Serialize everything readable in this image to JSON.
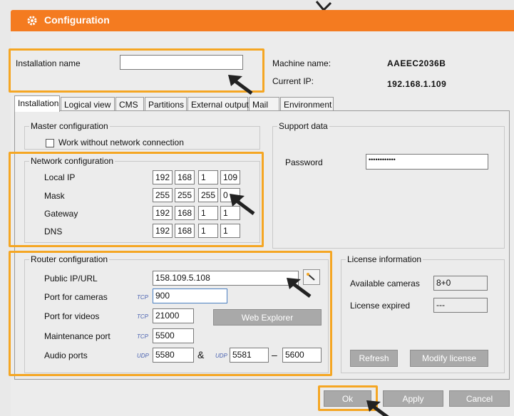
{
  "title": "Configuration",
  "top": {
    "installation_name_label": "Installation name",
    "installation_name_value": "",
    "machine_name_label": "Machine name:",
    "machine_name_value": "AAEEC2036B",
    "current_ip_label": "Current IP:",
    "current_ip_value": "192.168.1.109"
  },
  "tabs": [
    "Installation",
    "Logical view",
    "CMS",
    "Partitions",
    "External output",
    "Mail",
    "Environment"
  ],
  "master": {
    "title": "Master configuration",
    "checkbox_label": "Work without network connection"
  },
  "network": {
    "title": "Network configuration",
    "rows": [
      {
        "label": "Local IP",
        "octets": [
          "192",
          "168",
          "1",
          "109"
        ]
      },
      {
        "label": "Mask",
        "octets": [
          "255",
          "255",
          "255",
          "0"
        ]
      },
      {
        "label": "Gateway",
        "octets": [
          "192",
          "168",
          "1",
          "1"
        ]
      },
      {
        "label": "DNS",
        "octets": [
          "192",
          "168",
          "1",
          "1"
        ]
      }
    ]
  },
  "support": {
    "title": "Support data",
    "password_label": "Password",
    "password_value": "••••••••••••"
  },
  "router": {
    "title": "Router configuration",
    "public_ip_label": "Public IP/URL",
    "public_ip_value": "158.109.5.108",
    "port_cameras_label": "Port for cameras",
    "port_cameras_value": "900",
    "port_videos_label": "Port for videos",
    "port_videos_value": "21000",
    "maintenance_label": "Maintenance port",
    "maintenance_value": "5500",
    "audio_label": "Audio ports",
    "audio_value1": "5580",
    "audio_amp": "&",
    "audio_value2": "5581",
    "audio_dash": "–",
    "audio_value3": "5600",
    "tcp": "TCP",
    "udp": "UDP",
    "web_explorer": "Web Explorer"
  },
  "license": {
    "title": "License information",
    "available_label": "Available cameras",
    "available_value": "8+0",
    "expired_label": "License expired",
    "expired_value": "---",
    "refresh": "Refresh",
    "modify": "Modify license"
  },
  "buttons": {
    "ok": "Ok",
    "apply": "Apply",
    "cancel": "Cancel"
  },
  "colors": {
    "titlebar": "#f47b20",
    "highlight": "#f5a623"
  }
}
